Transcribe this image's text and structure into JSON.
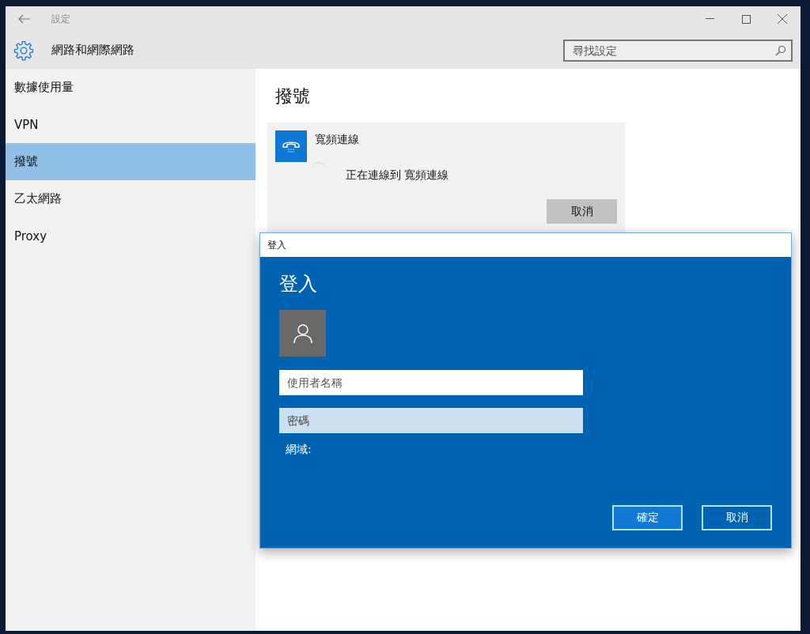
{
  "window": {
    "title": "設定"
  },
  "header": {
    "title": "網路和網際網路",
    "search": {
      "placeholder": "尋找設定"
    }
  },
  "sidebar": {
    "items": [
      {
        "label": "數據使用量",
        "selected": false
      },
      {
        "label": "VPN",
        "selected": false
      },
      {
        "label": "撥號",
        "selected": true
      },
      {
        "label": "乙太網路",
        "selected": false
      },
      {
        "label": "Proxy",
        "selected": false
      }
    ]
  },
  "page": {
    "heading": "撥號",
    "connection": {
      "name": "寬頻連線",
      "status": "正在連線到 寬頻連線",
      "cancel": "取消"
    }
  },
  "dialog": {
    "window_title": "登入",
    "heading": "登入",
    "username": {
      "placeholder": "使用者名稱"
    },
    "password": {
      "placeholder": "密碼"
    },
    "domain_label": "網域:",
    "buttons": [
      {
        "label": "確定",
        "default": true
      },
      {
        "label": "取消",
        "default": false
      }
    ]
  }
}
